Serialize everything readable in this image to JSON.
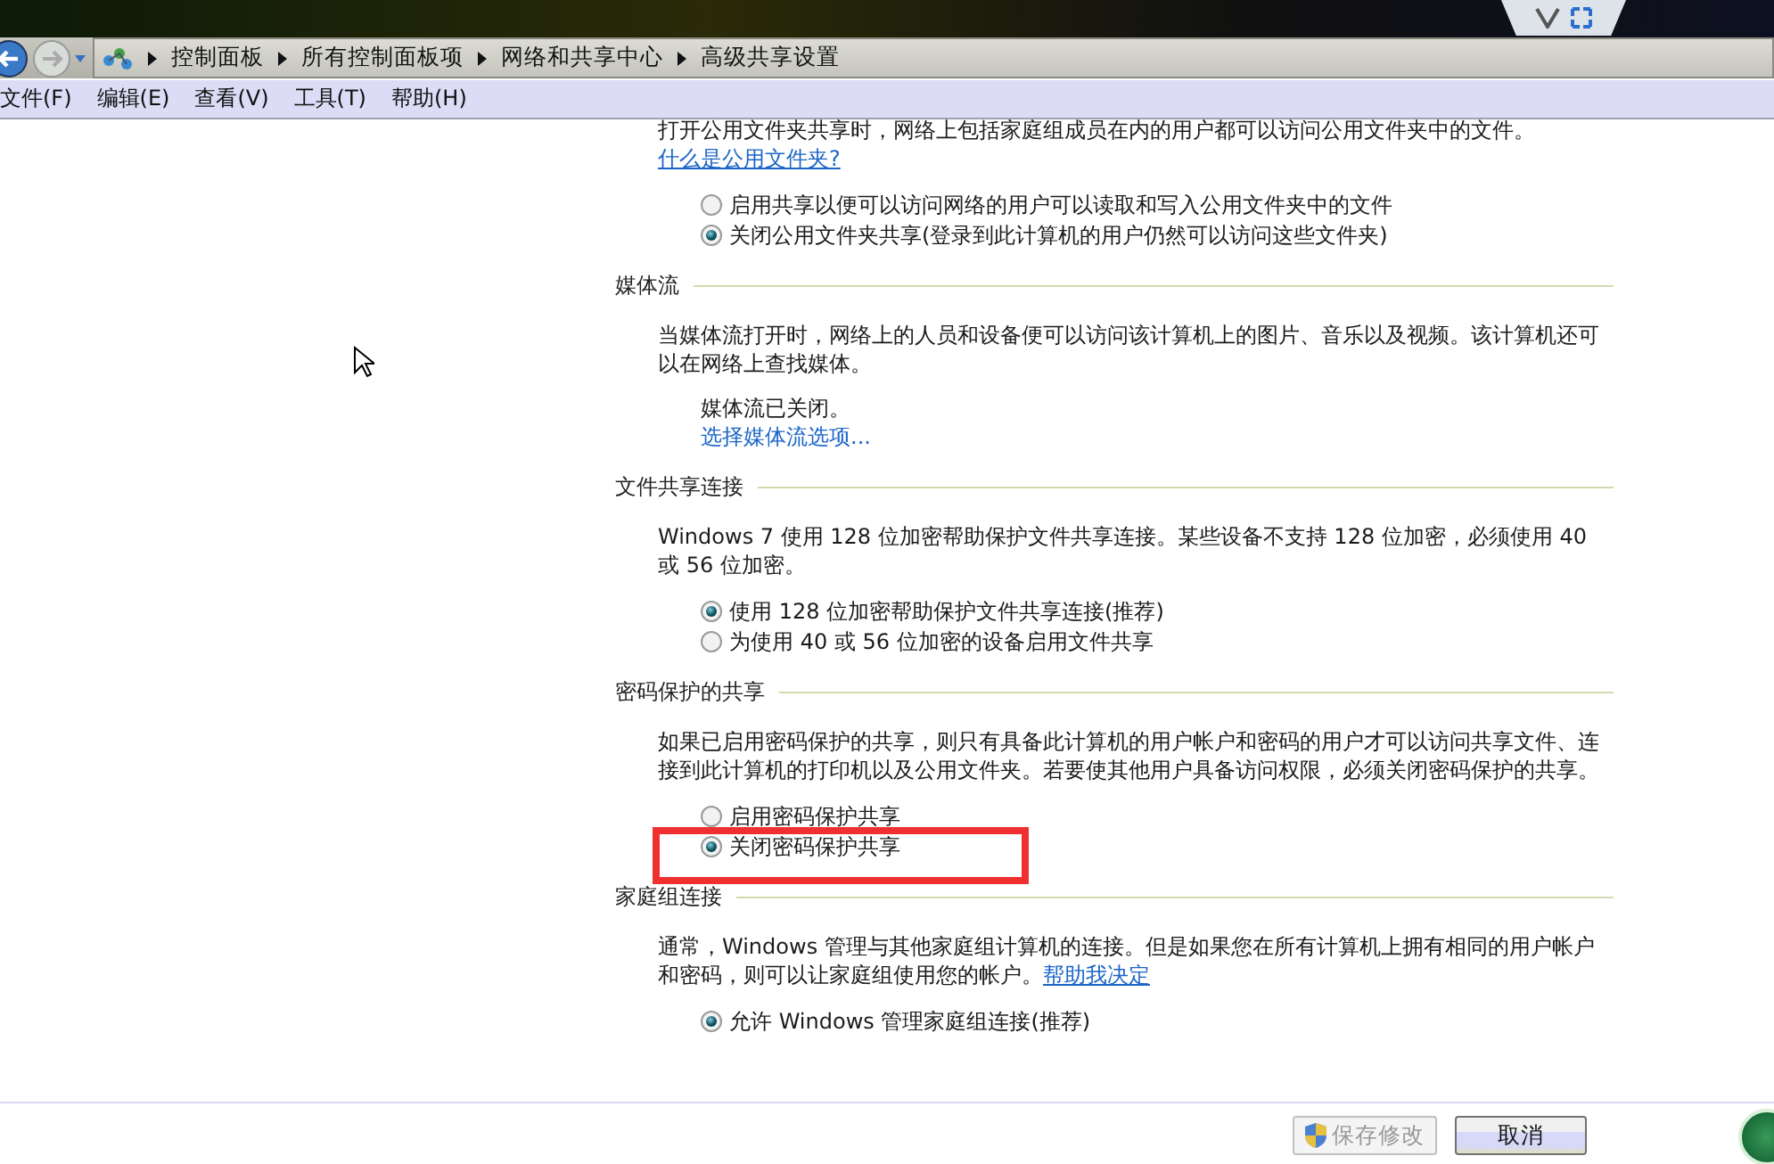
{
  "address_bar": {
    "breadcrumbs": [
      "控制面板",
      "所有控制面板项",
      "网络和共享中心",
      "高级共享设置"
    ]
  },
  "menu_bar": {
    "items": [
      "文件(F)",
      "编辑(E)",
      "查看(V)",
      "工具(T)",
      "帮助(H)"
    ]
  },
  "top_section": {
    "description": "打开公用文件夹共享时，网络上包括家庭组成员在内的用户都可以访问公用文件夹中的文件。",
    "link": "什么是公用文件夹?",
    "options": [
      {
        "label": "启用共享以便可以访问网络的用户可以读取和写入公用文件夹中的文件",
        "selected": false,
        "highlighted": false
      },
      {
        "label": "关闭公用文件夹共享(登录到此计算机的用户仍然可以访问这些文件夹)",
        "selected": true,
        "highlighted": false
      }
    ]
  },
  "sections": [
    {
      "title": "媒体流",
      "description": "当媒体流打开时，网络上的人员和设备便可以访问该计算机上的图片、音乐以及视频。该计算机还可以在网络上查找媒体。",
      "status": "媒体流已关闭。",
      "action_link": "选择媒体流选项..."
    },
    {
      "title": "文件共享连接",
      "description": "Windows 7 使用 128 位加密帮助保护文件共享连接。某些设备不支持 128 位加密，必须使用 40 或 56 位加密。",
      "options": [
        {
          "label": "使用 128 位加密帮助保护文件共享连接(推荐)",
          "selected": true,
          "highlighted": false
        },
        {
          "label": "为使用 40 或 56 位加密的设备启用文件共享",
          "selected": false,
          "highlighted": false
        }
      ]
    },
    {
      "title": "密码保护的共享",
      "description": "如果已启用密码保护的共享，则只有具备此计算机的用户帐户和密码的用户才可以访问共享文件、连接到此计算机的打印机以及公用文件夹。若要使其他用户具备访问权限，必须关闭密码保护的共享。",
      "options": [
        {
          "label": "启用密码保护共享",
          "selected": false,
          "highlighted": false
        },
        {
          "label": "关闭密码保护共享",
          "selected": true,
          "highlighted": true
        }
      ]
    },
    {
      "title": "家庭组连接",
      "description": "通常，Windows 管理与其他家庭组计算机的连接。但是如果您在所有计算机上拥有相同的用户帐户和密码，则可以让家庭组使用您的帐户。",
      "link": "帮助我决定",
      "options": [
        {
          "label": "允许 Windows 管理家庭组连接(推荐)",
          "selected": true,
          "highlighted": false
        }
      ]
    }
  ],
  "buttons": [
    {
      "label": "保存修改",
      "kind": "shield",
      "disabled": true
    },
    {
      "label": "取消",
      "kind": "plain",
      "disabled": false
    }
  ]
}
